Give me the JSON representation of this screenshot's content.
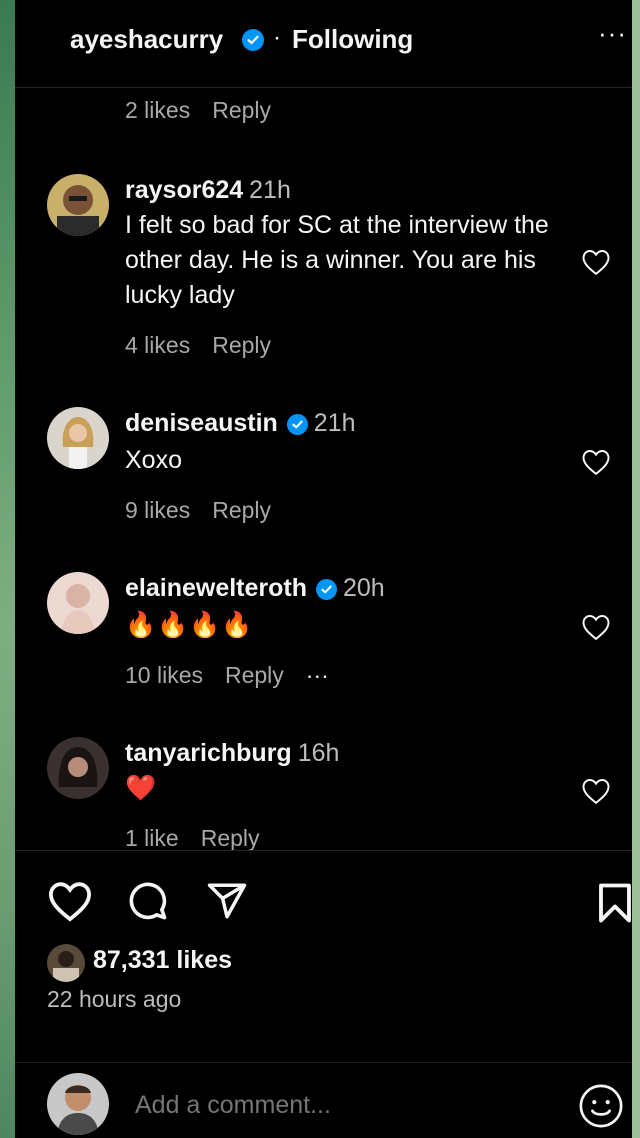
{
  "header": {
    "username": "ayeshacurry",
    "separator": "·",
    "following_label": "Following",
    "more_label": "···"
  },
  "top_comment_meta": {
    "likes": "2 likes",
    "reply": "Reply"
  },
  "comments": [
    {
      "username": "raysor624",
      "verified": false,
      "time": "21h",
      "text": "I felt so bad for SC at the interview the other day. He is a winner. You are his lucky lady",
      "likes": "4 likes",
      "reply": "Reply"
    },
    {
      "username": "deniseaustin",
      "verified": true,
      "time": "21h",
      "text": "Xoxo",
      "likes": "9 likes",
      "reply": "Reply"
    },
    {
      "username": "elainewelteroth",
      "verified": true,
      "time": "20h",
      "text": "🔥🔥🔥🔥",
      "likes": "10 likes",
      "reply": "Reply",
      "more": "···"
    },
    {
      "username": "tanyarichburg",
      "verified": false,
      "time": "16h",
      "text": "❤️",
      "likes": "1 like",
      "reply": "Reply"
    }
  ],
  "post": {
    "likes": "87,331 likes",
    "time_ago": "22 hours ago"
  },
  "add_comment": {
    "placeholder": "Add a comment..."
  },
  "icons": {
    "like": "heart-icon",
    "comment": "comment-icon",
    "share": "send-icon",
    "save": "bookmark-icon",
    "emoji": "smiley-icon",
    "verified": "verified-badge-icon"
  },
  "colors": {
    "background": "#000000",
    "text": "#f5f5f5",
    "muted": "#a8a8a8",
    "verified": "#0095f6",
    "fire": "#ff6a00",
    "heart": "#ff2d2d"
  }
}
